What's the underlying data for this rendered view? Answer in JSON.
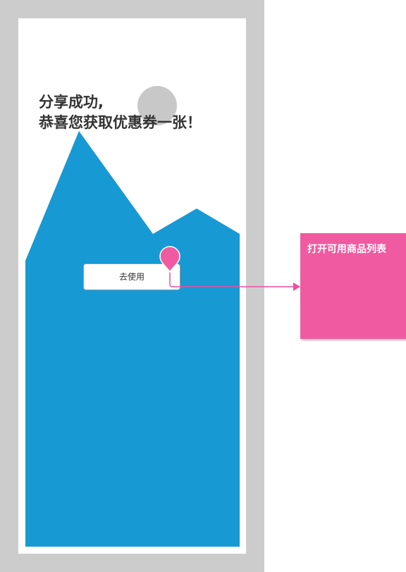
{
  "screen": {
    "headline_line1": "分享成功,",
    "headline_line2": "恭喜您获取优惠券一张！",
    "use_button_label": "去使用",
    "illustration": {
      "shape": "mountain-landscape-icon",
      "fill_color": "#1799d4",
      "sun_color": "#c8c8c8"
    }
  },
  "annotation": {
    "note_text": "打开可用商品列表",
    "note_color": "#f05aa0",
    "marker": "location-pin-icon",
    "marker_color": "#f05aa0",
    "connector_color": "#ec4f9e"
  },
  "colors": {
    "device_frame": "#cccccc",
    "screen_background": "#ffffff"
  }
}
